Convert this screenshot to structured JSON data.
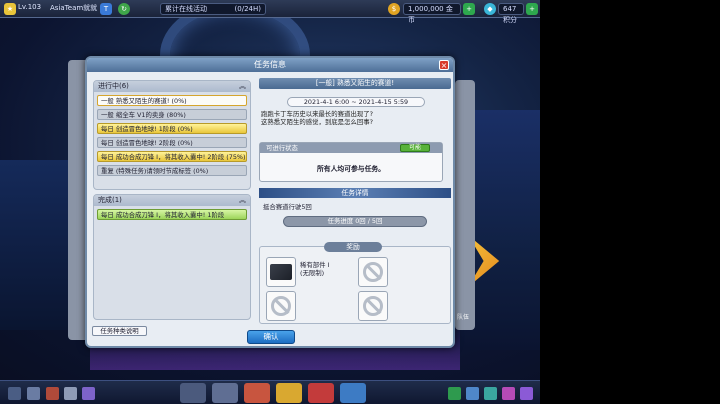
{
  "topbar": {
    "level": "Lv.103",
    "username": "AsiaTeam就就",
    "event_label": "累计在线活动",
    "event_time": "(0/24H)",
    "coins": "1,000,000 金币",
    "points": "647 积分"
  },
  "dialog": {
    "title": "任务信息",
    "close": "×",
    "left": {
      "in_progress_header": "进行中(6)",
      "in_progress": [
        {
          "text": "一般  熟悉又陌生的赛道! (0%)",
          "style": "white"
        },
        {
          "text": "一般  缩全车 V1的卖身 (80%)",
          "style": "grey"
        },
        {
          "text": "每日  创造冒色地球! 1阶段 (0%)",
          "style": "yellow"
        },
        {
          "text": "每日  创造冒色地球! 2阶段 (0%)",
          "style": "grey"
        },
        {
          "text": "每日  成功合成刀锋 I，将其收入囊中! 2阶段 (75%)",
          "style": "yellow"
        },
        {
          "text": "重复  (特殊任务)请领时节成标签 (0%)",
          "style": "grey"
        }
      ],
      "completed_header": "完成(1)",
      "completed": [
        {
          "text": "每日  成功合成刀锋 I，将其收入囊中! 1阶段",
          "style": "green"
        }
      ],
      "guide_button": "任务种类说明"
    },
    "right": {
      "quest_title": "[一般] 熟悉又陌生的赛道!",
      "date_range": "2021-4-1 6:00 ~ 2021-4-15 5:59",
      "description": "跑跑卡丁车历史以来最长的赛道出现了?\n这熟悉又陌生的感觉，到底是怎么回事?",
      "status_header": "可进行状态",
      "status_badge": "可能",
      "status_text": "所有人均可参与任务。",
      "detail_header": "任务详情",
      "detail_text": "挺合赛道行驶5回",
      "progress_text": "任务进度 0回 / 5回",
      "reward_header": "奖励",
      "reward_item_name": "稀有部件 I",
      "reward_item_sub": "(无限制)"
    },
    "confirm": "确认"
  },
  "side_labels": {
    "right_bottom": "队伍"
  },
  "colors": {
    "title_bar": "#4e6f97",
    "confirm": "#1d6dc2",
    "complete_green": "#9cd45a",
    "daily_yellow": "#e9c73a"
  }
}
